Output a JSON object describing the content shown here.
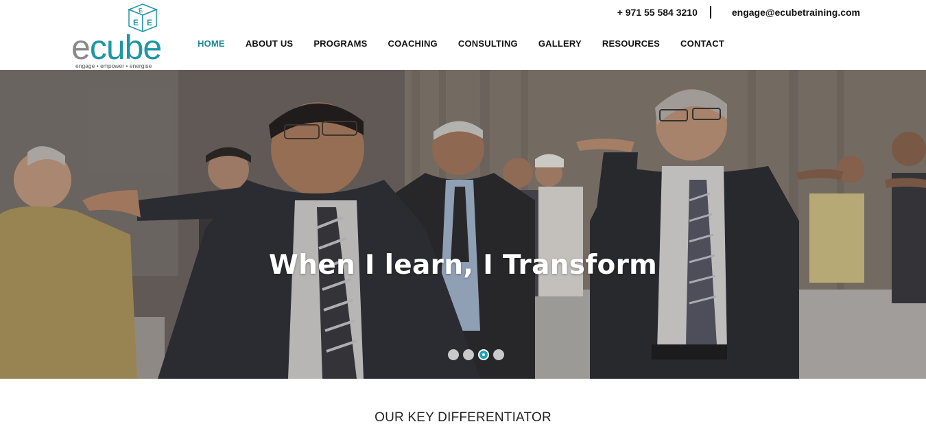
{
  "brand": {
    "name_prefix": "e",
    "name_rest": "cube",
    "tagline": "engage • empower • energise",
    "cube_letters": [
      "E",
      "E",
      "E"
    ]
  },
  "contact": {
    "phone": "+ 971 55 584 3210",
    "email": "engage@ecubetraining.com"
  },
  "nav": {
    "items": [
      {
        "label": "HOME",
        "active": true
      },
      {
        "label": "ABOUT US",
        "active": false
      },
      {
        "label": "PROGRAMS",
        "active": false
      },
      {
        "label": "COACHING",
        "active": false
      },
      {
        "label": "CONSULTING",
        "active": false
      },
      {
        "label": "GALLERY",
        "active": false
      },
      {
        "label": "RESOURCES",
        "active": false
      },
      {
        "label": "CONTACT",
        "active": false
      }
    ]
  },
  "hero": {
    "title": "When I learn, I Transform",
    "slides_total": 4,
    "active_slide": 3
  },
  "section": {
    "heading": "OUR KEY DIFFERENTIATOR"
  },
  "colors": {
    "accent": "#1e97a6",
    "nav_active": "#1e8a98",
    "dot_active": "#1fa3b1",
    "dot_inactive": "#c9c9c9"
  }
}
